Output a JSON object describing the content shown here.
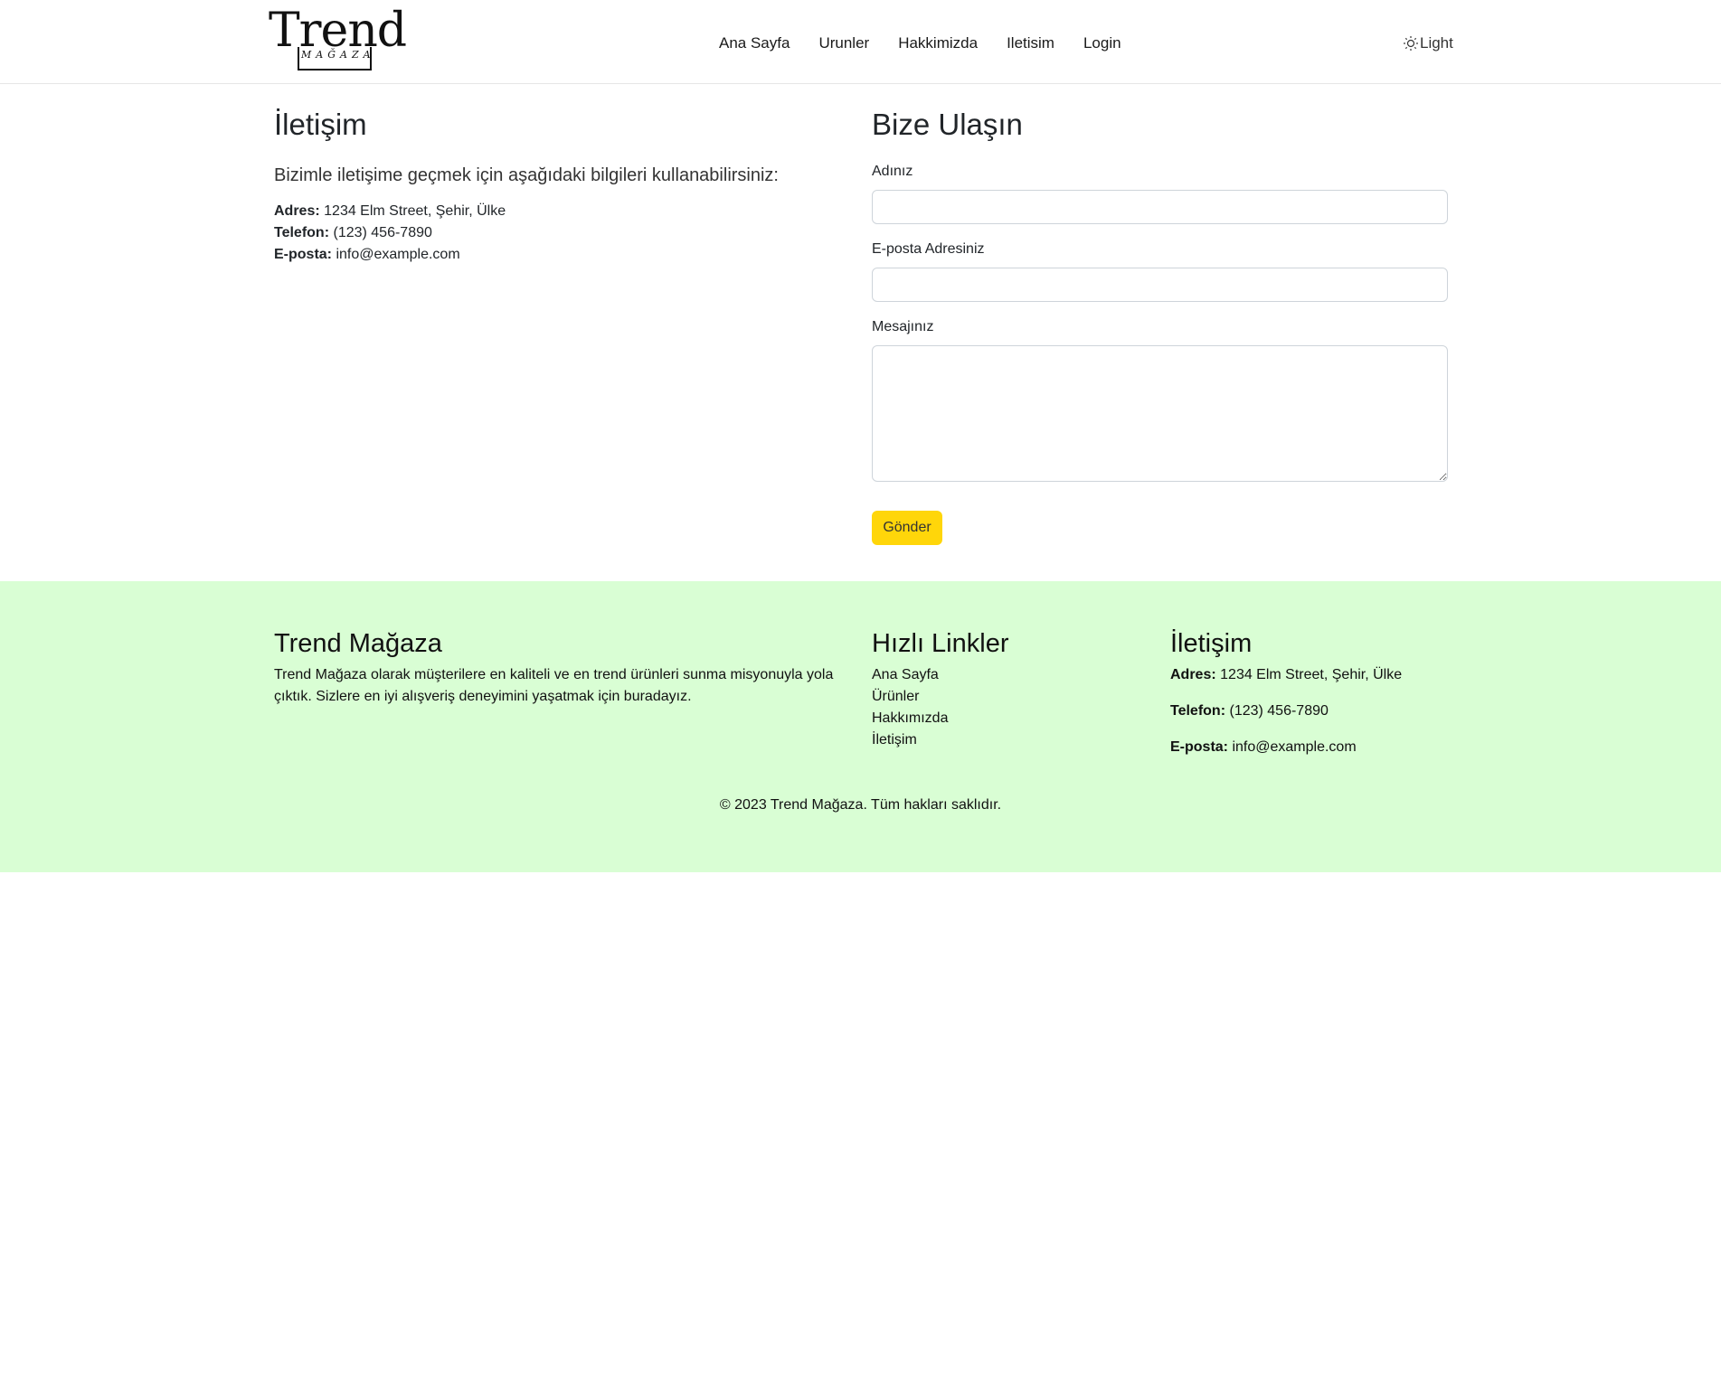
{
  "header": {
    "logo": {
      "word": "Trend",
      "sub": "MAĞAZA"
    },
    "nav": [
      "Ana Sayfa",
      "Urunler",
      "Hakkimizda",
      "Iletisim",
      "Login"
    ],
    "theme_toggle": {
      "label": "Light",
      "icon": "sun-icon"
    }
  },
  "contact_info": {
    "title": "İletişim",
    "lead": "Bizimle iletişime geçmek için aşağıdaki bilgileri kullanabilirsiniz:",
    "address_label": "Adres:",
    "address_value": "1234 Elm Street, Şehir, Ülke",
    "phone_label": "Telefon:",
    "phone_value": "(123) 456-7890",
    "email_label": "E-posta:",
    "email_value": "info@example.com"
  },
  "form": {
    "title": "Bize Ulaşın",
    "name_label": "Adınız",
    "name_value": "",
    "email_label": "E-posta Adresiniz",
    "email_value": "",
    "message_label": "Mesajınız",
    "message_value": "",
    "submit_label": "Gönder",
    "submit_color": "#ffd60a"
  },
  "footer": {
    "background": "#d9fed4",
    "about_title": "Trend Mağaza",
    "about_text": "Trend Mağaza olarak müşterilere en kaliteli ve en trend ürünleri sunma misyonuyla yola çıktık. Sizlere en iyi alışveriş deneyimini yaşatmak için buradayız.",
    "links_title": "Hızlı Linkler",
    "links": [
      "Ana Sayfa",
      "Ürünler",
      "Hakkımızda",
      "İletişim"
    ],
    "contact_title": "İletişim",
    "address_label": "Adres:",
    "address_value": "1234 Elm Street, Şehir, Ülke",
    "phone_label": "Telefon:",
    "phone_value": "(123) 456-7890",
    "email_label": "E-posta:",
    "email_value": "info@example.com",
    "copyright": "© 2023 Trend Mağaza. Tüm hakları saklıdır."
  }
}
